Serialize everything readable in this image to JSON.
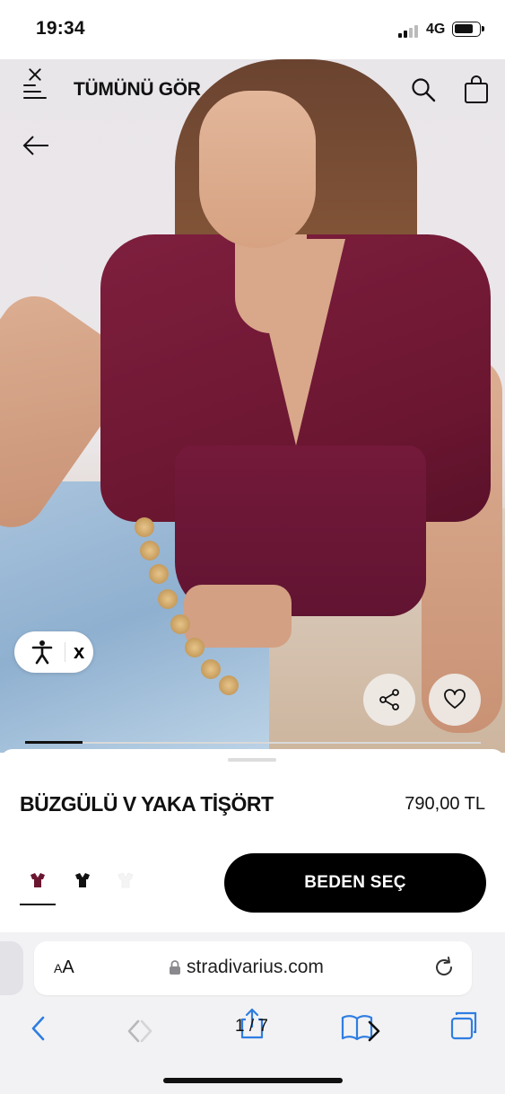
{
  "status_bar": {
    "time": "19:34",
    "network": "4G"
  },
  "nav": {
    "title": "TÜMÜNÜ GÖR"
  },
  "gallery": {
    "progress": 0.125
  },
  "accessibility": {
    "close_label": "x"
  },
  "product": {
    "name": "BÜZGÜLÜ V YAKA TİŞÖRT",
    "price": "790,00 TL",
    "colors": [
      {
        "name": "bordo",
        "hex": "#6b1631"
      },
      {
        "name": "siyah",
        "hex": "#111111"
      },
      {
        "name": "beyaz",
        "hex": "#f4f4f4"
      }
    ],
    "selected_color": 0,
    "size_button_label": "BEDEN SEÇ"
  },
  "browser": {
    "text_size_label": "AA",
    "url": "stradivarius.com",
    "page_indicator": "1 / 7"
  },
  "colors": {
    "accent": "#000000",
    "link_blue": "#2f7de1"
  }
}
